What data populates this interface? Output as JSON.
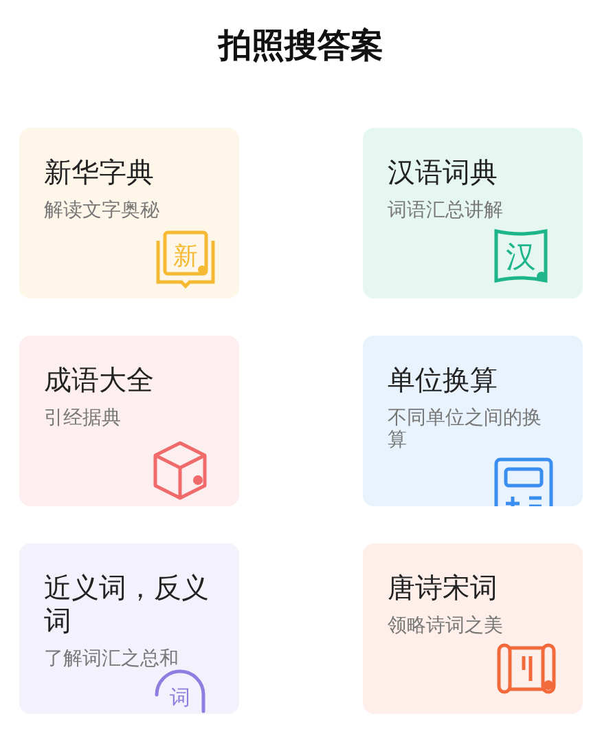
{
  "header": {
    "title": "拍照搜答案"
  },
  "cards": [
    {
      "title": "新华字典",
      "subtitle": "解读文字奥秘",
      "kind": "book",
      "icon_text": "新",
      "color": "#f5b933"
    },
    {
      "title": "汉语词典",
      "subtitle": "词语汇总讲解",
      "kind": "page",
      "icon_text": "汉",
      "color": "#1fb58a"
    },
    {
      "title": "成语大全",
      "subtitle": "引经据典",
      "kind": "cube",
      "color": "#f06a6a"
    },
    {
      "title": "单位换算",
      "subtitle": "不同单位之间的换算",
      "kind": "calculator",
      "color": "#3a8ef0"
    },
    {
      "title": "近义词，反义词",
      "subtitle": "了解词汇之总和",
      "kind": "circle",
      "icon_text": "词",
      "color": "#8c7fe0"
    },
    {
      "title": "唐诗宋词",
      "subtitle": "领略诗词之美",
      "kind": "scroll",
      "color": "#f26a3c"
    }
  ]
}
